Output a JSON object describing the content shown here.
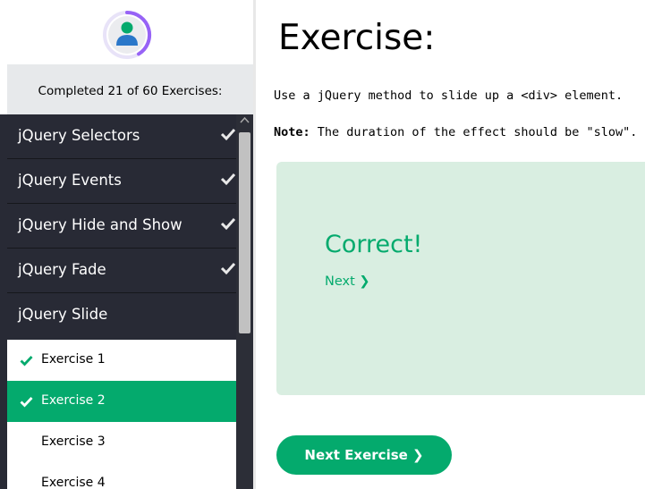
{
  "sidebar": {
    "progress_text": "Completed 21 of 60 Exercises:",
    "menu": [
      {
        "label": "jQuery Selectors",
        "done": true
      },
      {
        "label": "jQuery Events",
        "done": true
      },
      {
        "label": "jQuery Hide and Show",
        "done": true
      },
      {
        "label": "jQuery Fade",
        "done": true
      },
      {
        "label": "jQuery Slide",
        "done": false
      }
    ],
    "sub_items": [
      {
        "label": "Exercise 1",
        "done": true,
        "active": false
      },
      {
        "label": "Exercise 2",
        "done": true,
        "active": true
      },
      {
        "label": "Exercise 3",
        "done": false,
        "active": false
      },
      {
        "label": "Exercise 4",
        "done": false,
        "active": false
      }
    ]
  },
  "main": {
    "title": "Exercise:",
    "instruction": "Use a jQuery method to slide up a <div> element.",
    "note_label": "Note:",
    "note_text": " The duration of the effect should be \"slow\".",
    "result": {
      "status": "Correct!",
      "next_link": "Next ❯"
    },
    "next_exercise_button": "Next Exercise ❯"
  },
  "colors": {
    "accent": "#04AA6D",
    "sidebar_bg": "#282A35",
    "result_bg": "#D9EEE1",
    "avatar_ring": "#9763f6"
  }
}
